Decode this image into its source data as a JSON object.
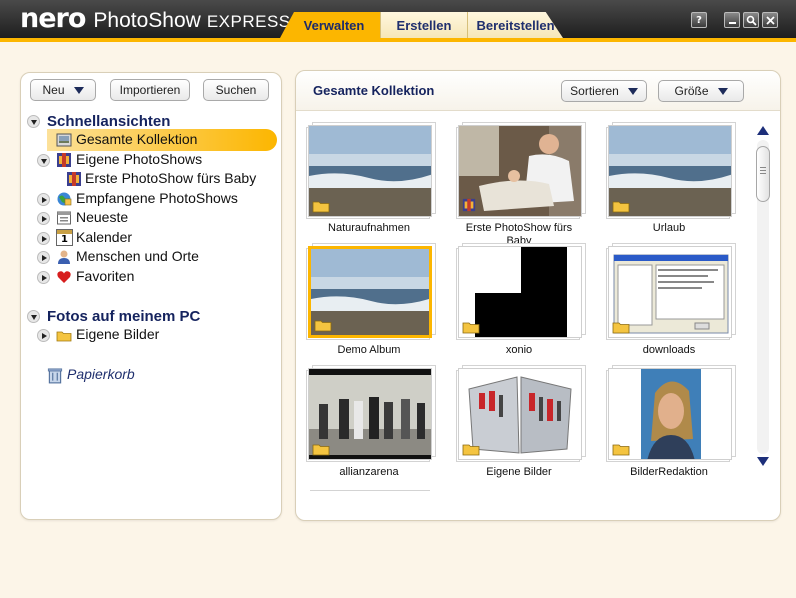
{
  "app": {
    "brand": "nero",
    "product": "PhotoShow",
    "edition": "EXPRESS",
    "tabs": [
      "Verwalten",
      "Erstellen",
      "Bereitstellen"
    ]
  },
  "window_buttons": {
    "help": "?",
    "minimize": "_",
    "search": "🔍",
    "close": "×"
  },
  "toolbar": {
    "new_label": "Neu",
    "import_label": "Importieren",
    "search_label": "Suchen"
  },
  "tree": {
    "quick_views_heading": "Schnellansichten",
    "items": [
      "Gesamte Kollektion",
      "Eigene PhotoShows",
      "Erste PhotoShow fürs Baby",
      "Empfangene PhotoShows",
      "Neueste",
      "Kalender",
      "Menschen und Orte",
      "Favoriten"
    ],
    "pc_heading": "Fotos auf meinem PC",
    "pc_items": [
      "Eigene Bilder"
    ],
    "trash": "Papierkorb",
    "calendar_day": "1"
  },
  "collection": {
    "title": "Gesamte Kollektion",
    "sort_label": "Sortieren",
    "size_label": "Größe",
    "items": [
      {
        "caption": "Naturaufnahmen",
        "kind": "album"
      },
      {
        "caption": "Erste PhotoShow fürs Baby",
        "kind": "photoshow"
      },
      {
        "caption": "Urlaub",
        "kind": "album"
      },
      {
        "caption": "Demo Album",
        "kind": "album",
        "selected": true
      },
      {
        "caption": "xonio",
        "kind": "album"
      },
      {
        "caption": "downloads",
        "kind": "album"
      },
      {
        "caption": "allianzarena",
        "kind": "album"
      },
      {
        "caption": "Eigene Bilder",
        "kind": "album"
      },
      {
        "caption": "BilderRedaktion",
        "kind": "album"
      }
    ]
  },
  "colors": {
    "accent": "#fcb600",
    "heading": "#15235e",
    "titlebar": "#2a2a2a"
  }
}
